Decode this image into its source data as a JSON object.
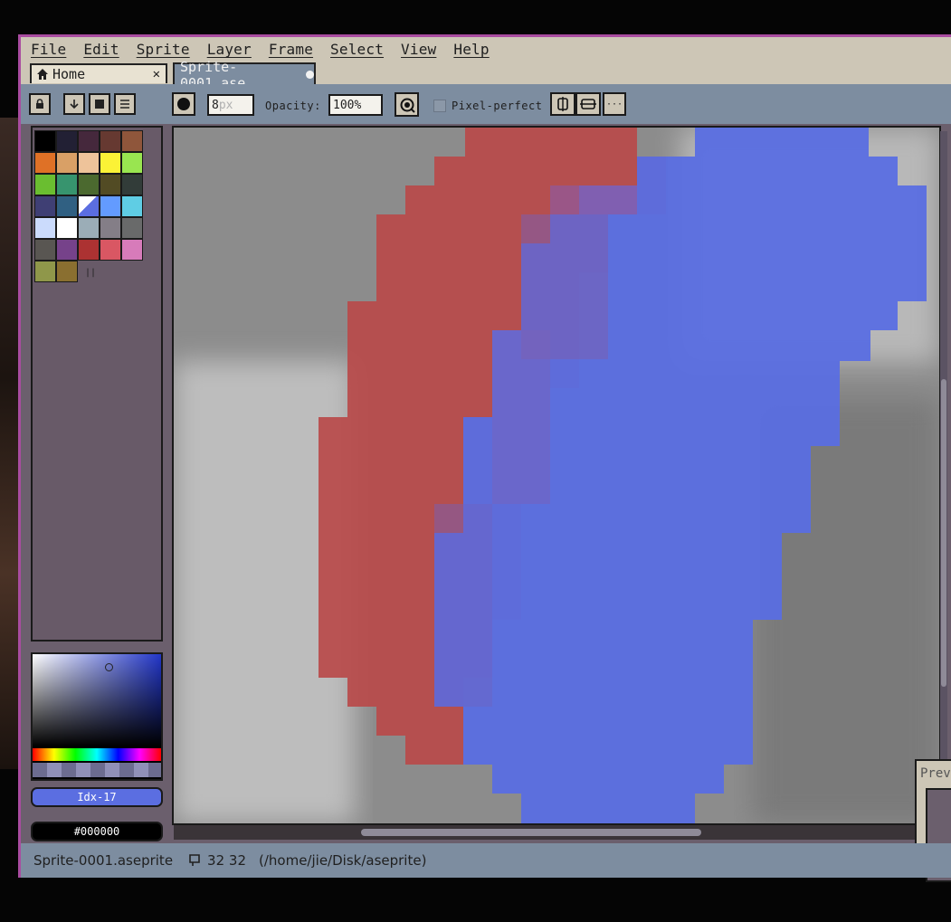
{
  "menu": {
    "items": [
      "File",
      "Edit",
      "Sprite",
      "Layer",
      "Frame",
      "Select",
      "View",
      "Help"
    ]
  },
  "tabs": {
    "home_label": "Home",
    "close_glyph": "✕",
    "sprite_label": "Sprite-0001.ase"
  },
  "context_bar": {
    "brush_size": "8",
    "brush_size_unit": "px",
    "opacity_label": "Opacity:",
    "opacity_value": "100%",
    "pixel_perfect_label": "Pixel-perfect",
    "more_glyph": "···",
    "icons": [
      "lock-icon",
      "down-arrow-icon",
      "square-icon",
      "menu-icon",
      "circle-brush-icon",
      "ink-icon",
      "symmetry-x-icon",
      "symmetry-y-icon"
    ]
  },
  "palette": {
    "handle_glyph": "||",
    "colors": [
      "#000000",
      "#222034",
      "#45283c",
      "#663931",
      "#8f563b",
      "#df7126",
      "#d9a066",
      "#eec39a",
      "#fbf236",
      "#99e550",
      "#6abe30",
      "#37946e",
      "#4b692f",
      "#524b24",
      "#323c39",
      "#3f3f74",
      "#306082",
      "#5b6ee1",
      "#639bff",
      "#5fcde4",
      "#cbdbfc",
      "#ffffff",
      "#9badb7",
      "#847e87",
      "#696a6a",
      "#595652",
      "#76428a",
      "#ac3232",
      "#d95763",
      "#d77bba",
      "#8f974a",
      "#8a6f30"
    ]
  },
  "colors": {
    "foreground_label": "Idx-17",
    "foreground_color": "#5b6ee1",
    "background_label": "#000000",
    "background_color": "#000000"
  },
  "preview": {
    "title": "Prev"
  },
  "status": {
    "filename": "Sprite-0001.aseprite",
    "size": "32 32",
    "path": "(/home/jie/Disk/aseprite)"
  }
}
